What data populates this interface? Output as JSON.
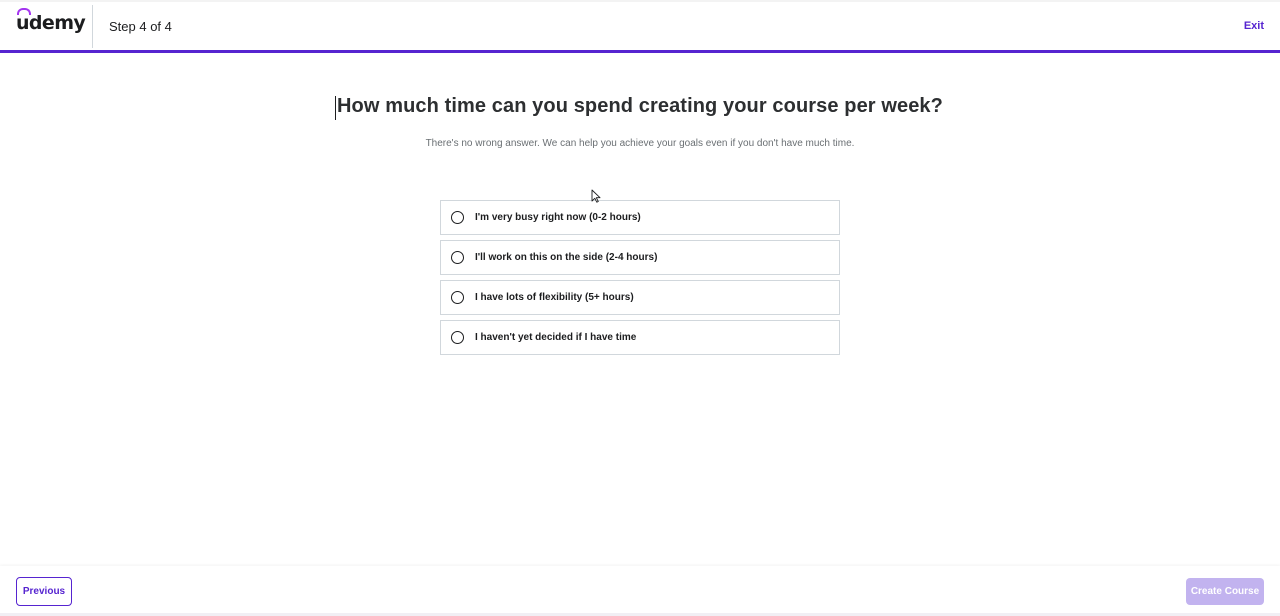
{
  "header": {
    "logo": "udemy",
    "step_text": "Step 4 of 4",
    "exit_label": "Exit",
    "progress": 1.0,
    "accent_color": "#5624d0"
  },
  "main": {
    "title": "How much time can you spend creating your course per week?",
    "subtitle": "There's no wrong answer. We can help you achieve your goals even if you don't have much time.",
    "options": [
      {
        "label": "I'm very busy right now (0-2 hours)",
        "selected": false
      },
      {
        "label": "I'll work on this on the side (2-4 hours)",
        "selected": false
      },
      {
        "label": "I have lots of flexibility (5+ hours)",
        "selected": false
      },
      {
        "label": "I haven't yet decided if I have time",
        "selected": false
      }
    ]
  },
  "footer": {
    "previous_label": "Previous",
    "create_label": "Create Course",
    "create_enabled": false
  },
  "icons": {
    "radio": "radio-unchecked-icon",
    "pointer": "mouse-pointer-icon"
  }
}
